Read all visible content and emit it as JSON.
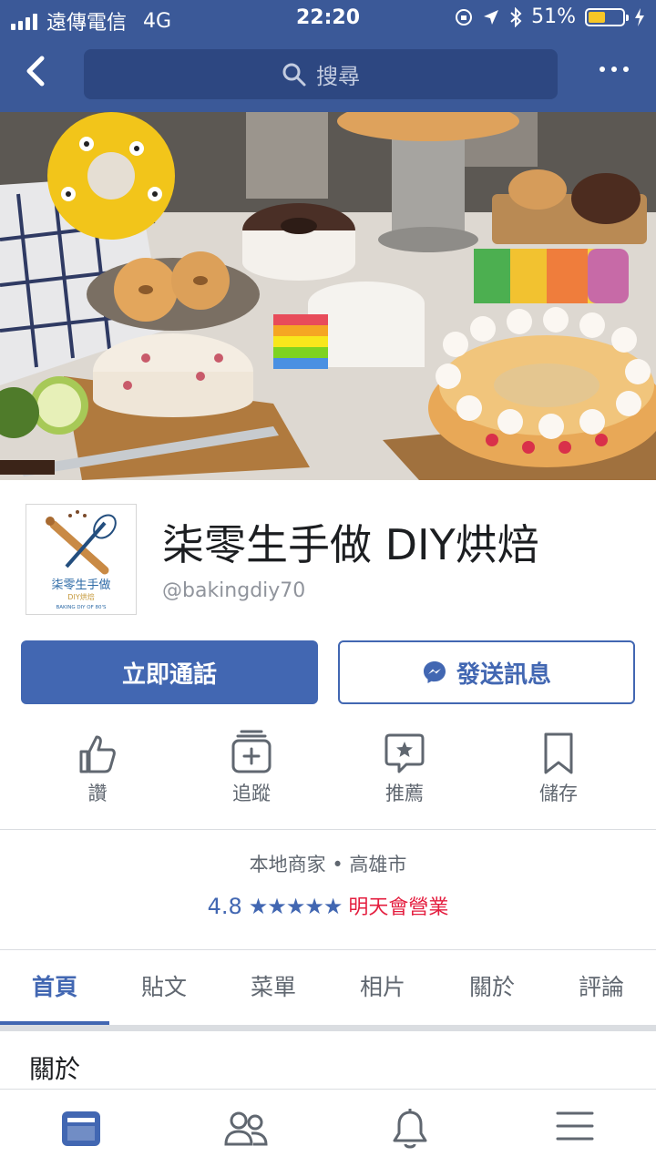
{
  "status_bar": {
    "carrier": "遠傳電信",
    "network": "4G",
    "time": "22:20",
    "battery_percent": "51%",
    "battery_level": 0.51,
    "battery_color": "#f7c626"
  },
  "nav": {
    "search_placeholder": "搜尋",
    "back_icon": "chevron-left-icon",
    "more_icon": "more-dots-icon"
  },
  "page": {
    "name": "柒零生手做 DIY烘焙",
    "handle": "@bakingdiy70",
    "logo_text": "柒零生手做",
    "logo_sub": "DIY烘焙",
    "logo_ring": "BAKING DIY OF 80'S"
  },
  "actions": {
    "call_label": "立即通話",
    "message_label": "發送訊息"
  },
  "quick_actions": [
    {
      "label": "讚",
      "icon": "thumbs-up-icon"
    },
    {
      "label": "追蹤",
      "icon": "follow-icon"
    },
    {
      "label": "推薦",
      "icon": "recommend-icon"
    },
    {
      "label": "儲存",
      "icon": "bookmark-icon"
    }
  ],
  "info": {
    "category": "本地商家",
    "city": "高雄市",
    "rating": "4.8",
    "stars": "★★★★★",
    "hours_status": "明天會營業"
  },
  "tabs": [
    {
      "label": "首頁",
      "active": true
    },
    {
      "label": "貼文",
      "active": false
    },
    {
      "label": "菜單",
      "active": false
    },
    {
      "label": "相片",
      "active": false
    },
    {
      "label": "關於",
      "active": false
    },
    {
      "label": "評論",
      "active": false
    }
  ],
  "section": {
    "about_title": "關於"
  },
  "bottom_tabs": [
    {
      "icon": "news-feed-icon",
      "active": true
    },
    {
      "icon": "friends-icon",
      "active": false
    },
    {
      "icon": "notifications-bell-icon",
      "active": false
    },
    {
      "icon": "menu-hamburger-icon",
      "active": false
    }
  ],
  "colors": {
    "brand": "#3b5998",
    "accent": "#4267b2",
    "open_status": "#e41e3f"
  }
}
